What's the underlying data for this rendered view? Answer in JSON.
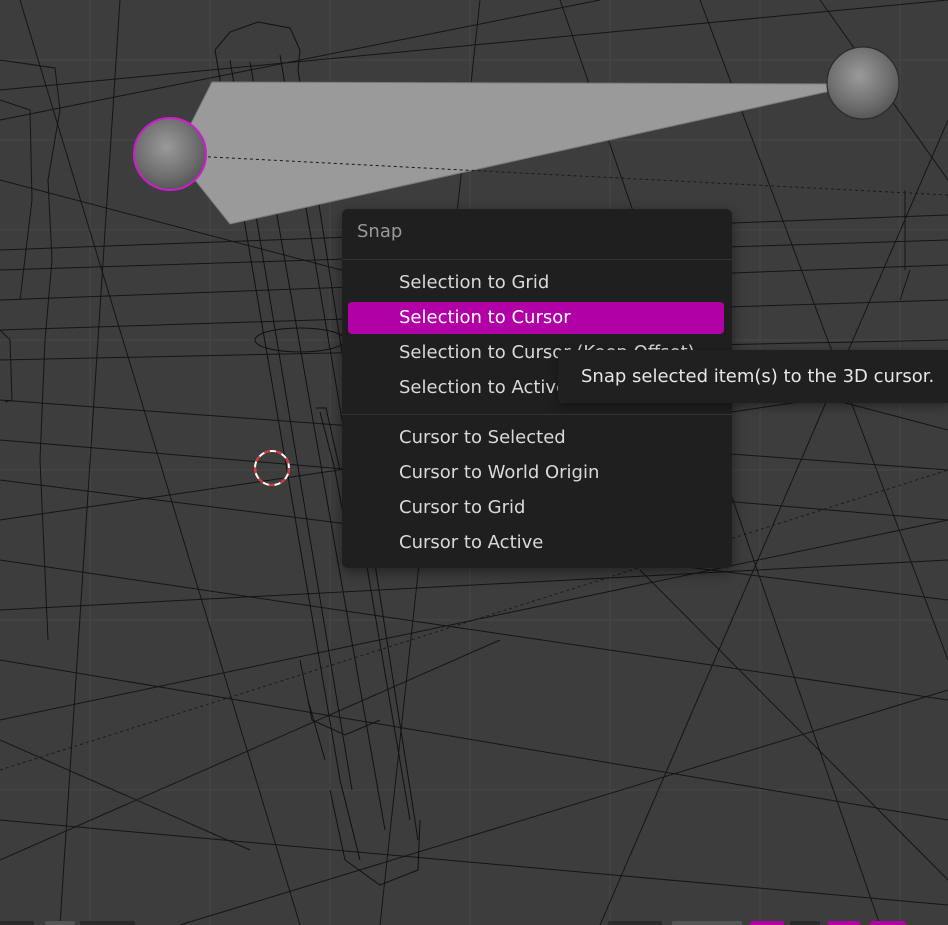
{
  "snap_menu": {
    "title": "Snap",
    "items": [
      {
        "label": "Selection to Grid",
        "highlighted": false
      },
      {
        "label": "Selection to Cursor",
        "highlighted": true
      },
      {
        "label": "Selection to Cursor (Keep Offset)",
        "highlighted": false
      },
      {
        "label": "Selection to Active",
        "highlighted": false
      },
      {
        "label": "Cursor to Selected",
        "highlighted": false
      },
      {
        "label": "Cursor to World Origin",
        "highlighted": false
      },
      {
        "label": "Cursor to Grid",
        "highlighted": false
      },
      {
        "label": "Cursor to Active",
        "highlighted": false
      }
    ]
  },
  "tooltip": {
    "text": "Snap selected item(s) to the 3D cursor."
  },
  "colors": {
    "background": "#3d3d3d",
    "menu_bg": "#1f1f1f",
    "highlight": "#b100a5",
    "selection_outline": "#d21ad2",
    "cursor_red": "#e03030",
    "wire": "#111111"
  },
  "icons": {
    "selected_light": "selected-light-icon",
    "light": "light-icon",
    "spot_cone": "spot-cone-icon",
    "cursor_3d": "3d-cursor-icon"
  }
}
